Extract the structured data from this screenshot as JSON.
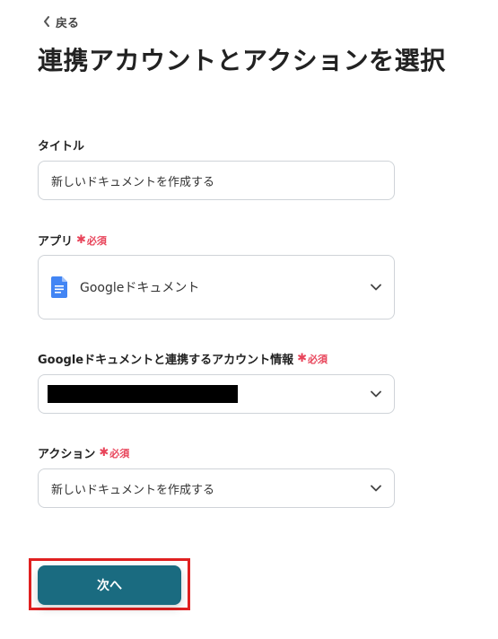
{
  "back": {
    "label": "戻る"
  },
  "page_title": "連携アカウントとアクションを選択",
  "required_label": "必須",
  "fields": {
    "title": {
      "label": "タイトル",
      "value": "新しいドキュメントを作成する"
    },
    "app": {
      "label": "アプリ",
      "value": "Googleドキュメント",
      "icon": "google-docs-icon",
      "icon_color": "#4285f4"
    },
    "account": {
      "label": "Googleドキュメントと連携するアカウント情報"
    },
    "action": {
      "label": "アクション",
      "value": "新しいドキュメントを作成する"
    }
  },
  "next_button": {
    "label": "次へ",
    "color": "#1a6b80",
    "highlight_color": "#e02020"
  },
  "colors": {
    "required": "#e8445a"
  }
}
